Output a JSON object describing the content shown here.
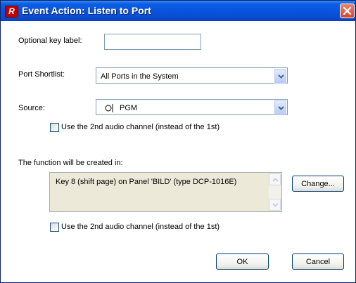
{
  "window": {
    "title": "Event Action: Listen to Port",
    "app_icon_letter": "R"
  },
  "form": {
    "key_label": {
      "label": "Optional key label:",
      "value": ""
    },
    "port_shortlist": {
      "label": "Port Shortlist:",
      "selected": "All Ports in the System"
    },
    "source": {
      "label": "Source:",
      "selected": "PGM"
    },
    "audio_channel_1": {
      "label": "Use the 2nd audio channel (instead of the 1st)",
      "checked": false
    },
    "function_location": {
      "label": "The function will be created in:",
      "text": "Key 8 (shift page) on Panel 'BILD' (type DCP-1016E)"
    },
    "change_button": "Change...",
    "audio_channel_2": {
      "label": "Use the 2nd audio channel (instead of the 1st)",
      "checked": false
    }
  },
  "footer": {
    "ok": "OK",
    "cancel": "Cancel"
  },
  "icons": [
    "app-icon",
    "close-icon",
    "chevron-down-icon",
    "audio-source-icon",
    "scroll-up-icon",
    "scroll-down-icon"
  ]
}
